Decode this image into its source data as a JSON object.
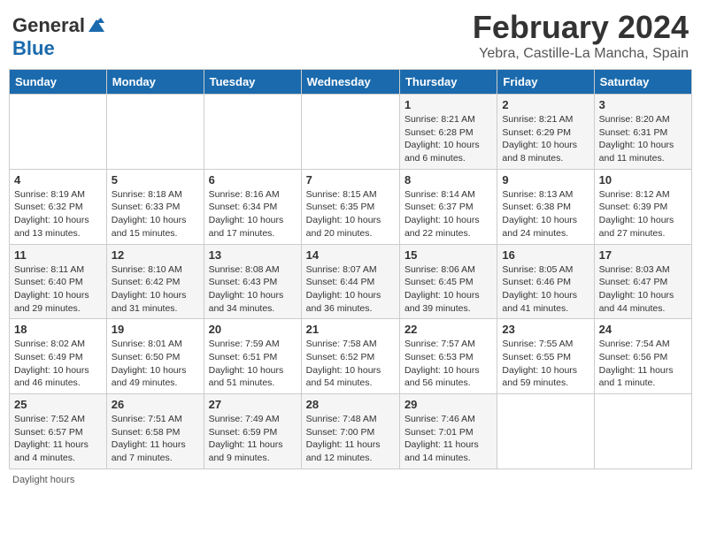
{
  "header": {
    "logo_general": "General",
    "logo_blue": "Blue",
    "month_title": "February 2024",
    "location": "Yebra, Castille-La Mancha, Spain"
  },
  "weekdays": [
    "Sunday",
    "Monday",
    "Tuesday",
    "Wednesday",
    "Thursday",
    "Friday",
    "Saturday"
  ],
  "weeks": [
    [
      {
        "day": "",
        "info": ""
      },
      {
        "day": "",
        "info": ""
      },
      {
        "day": "",
        "info": ""
      },
      {
        "day": "",
        "info": ""
      },
      {
        "day": "1",
        "info": "Sunrise: 8:21 AM\nSunset: 6:28 PM\nDaylight: 10 hours and 6 minutes."
      },
      {
        "day": "2",
        "info": "Sunrise: 8:21 AM\nSunset: 6:29 PM\nDaylight: 10 hours and 8 minutes."
      },
      {
        "day": "3",
        "info": "Sunrise: 8:20 AM\nSunset: 6:31 PM\nDaylight: 10 hours and 11 minutes."
      }
    ],
    [
      {
        "day": "4",
        "info": "Sunrise: 8:19 AM\nSunset: 6:32 PM\nDaylight: 10 hours and 13 minutes."
      },
      {
        "day": "5",
        "info": "Sunrise: 8:18 AM\nSunset: 6:33 PM\nDaylight: 10 hours and 15 minutes."
      },
      {
        "day": "6",
        "info": "Sunrise: 8:16 AM\nSunset: 6:34 PM\nDaylight: 10 hours and 17 minutes."
      },
      {
        "day": "7",
        "info": "Sunrise: 8:15 AM\nSunset: 6:35 PM\nDaylight: 10 hours and 20 minutes."
      },
      {
        "day": "8",
        "info": "Sunrise: 8:14 AM\nSunset: 6:37 PM\nDaylight: 10 hours and 22 minutes."
      },
      {
        "day": "9",
        "info": "Sunrise: 8:13 AM\nSunset: 6:38 PM\nDaylight: 10 hours and 24 minutes."
      },
      {
        "day": "10",
        "info": "Sunrise: 8:12 AM\nSunset: 6:39 PM\nDaylight: 10 hours and 27 minutes."
      }
    ],
    [
      {
        "day": "11",
        "info": "Sunrise: 8:11 AM\nSunset: 6:40 PM\nDaylight: 10 hours and 29 minutes."
      },
      {
        "day": "12",
        "info": "Sunrise: 8:10 AM\nSunset: 6:42 PM\nDaylight: 10 hours and 31 minutes."
      },
      {
        "day": "13",
        "info": "Sunrise: 8:08 AM\nSunset: 6:43 PM\nDaylight: 10 hours and 34 minutes."
      },
      {
        "day": "14",
        "info": "Sunrise: 8:07 AM\nSunset: 6:44 PM\nDaylight: 10 hours and 36 minutes."
      },
      {
        "day": "15",
        "info": "Sunrise: 8:06 AM\nSunset: 6:45 PM\nDaylight: 10 hours and 39 minutes."
      },
      {
        "day": "16",
        "info": "Sunrise: 8:05 AM\nSunset: 6:46 PM\nDaylight: 10 hours and 41 minutes."
      },
      {
        "day": "17",
        "info": "Sunrise: 8:03 AM\nSunset: 6:47 PM\nDaylight: 10 hours and 44 minutes."
      }
    ],
    [
      {
        "day": "18",
        "info": "Sunrise: 8:02 AM\nSunset: 6:49 PM\nDaylight: 10 hours and 46 minutes."
      },
      {
        "day": "19",
        "info": "Sunrise: 8:01 AM\nSunset: 6:50 PM\nDaylight: 10 hours and 49 minutes."
      },
      {
        "day": "20",
        "info": "Sunrise: 7:59 AM\nSunset: 6:51 PM\nDaylight: 10 hours and 51 minutes."
      },
      {
        "day": "21",
        "info": "Sunrise: 7:58 AM\nSunset: 6:52 PM\nDaylight: 10 hours and 54 minutes."
      },
      {
        "day": "22",
        "info": "Sunrise: 7:57 AM\nSunset: 6:53 PM\nDaylight: 10 hours and 56 minutes."
      },
      {
        "day": "23",
        "info": "Sunrise: 7:55 AM\nSunset: 6:55 PM\nDaylight: 10 hours and 59 minutes."
      },
      {
        "day": "24",
        "info": "Sunrise: 7:54 AM\nSunset: 6:56 PM\nDaylight: 11 hours and 1 minute."
      }
    ],
    [
      {
        "day": "25",
        "info": "Sunrise: 7:52 AM\nSunset: 6:57 PM\nDaylight: 11 hours and 4 minutes."
      },
      {
        "day": "26",
        "info": "Sunrise: 7:51 AM\nSunset: 6:58 PM\nDaylight: 11 hours and 7 minutes."
      },
      {
        "day": "27",
        "info": "Sunrise: 7:49 AM\nSunset: 6:59 PM\nDaylight: 11 hours and 9 minutes."
      },
      {
        "day": "28",
        "info": "Sunrise: 7:48 AM\nSunset: 7:00 PM\nDaylight: 11 hours and 12 minutes."
      },
      {
        "day": "29",
        "info": "Sunrise: 7:46 AM\nSunset: 7:01 PM\nDaylight: 11 hours and 14 minutes."
      },
      {
        "day": "",
        "info": ""
      },
      {
        "day": "",
        "info": ""
      }
    ]
  ],
  "footer": {
    "daylight_label": "Daylight hours"
  }
}
